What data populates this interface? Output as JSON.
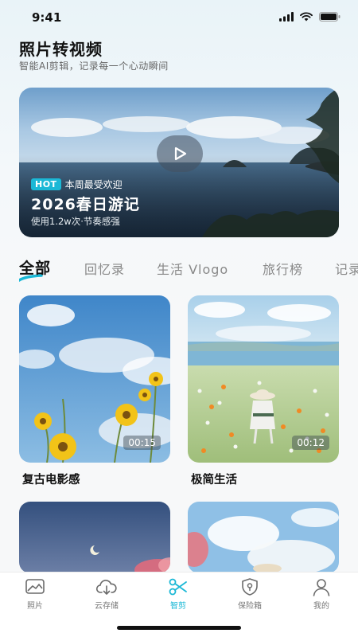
{
  "status_bar": {
    "time": "9:41",
    "icons": [
      "signal-icon",
      "wifi-icon",
      "battery-icon"
    ]
  },
  "header": {
    "title": "照片转视频",
    "subtitle": "智能AI剪辑，记录每一个心动瞬间"
  },
  "hero": {
    "badge": "HOT",
    "badge_text": "本周最受欢迎",
    "title": "2026春日游记",
    "meta": "使用1.2w次·节奏感强",
    "icon": "play-icon"
  },
  "tabs": [
    {
      "label": "全部",
      "active": true
    },
    {
      "label": "回忆录",
      "active": false
    },
    {
      "label": "生活 Vlogo",
      "active": false
    },
    {
      "label": "旅行榜",
      "active": false
    },
    {
      "label": "记录",
      "active": false
    }
  ],
  "cards": [
    {
      "title": "复古电影感",
      "duration": "00:15"
    },
    {
      "title": "极简生活",
      "duration": "00:12"
    }
  ],
  "bottom_nav": [
    {
      "label": "照片",
      "icon": "photo-icon",
      "active": false
    },
    {
      "label": "云存储",
      "icon": "cloud-download-icon",
      "active": false
    },
    {
      "label": "智剪",
      "icon": "scissors-icon",
      "active": true
    },
    {
      "label": "保险箱",
      "icon": "shield-icon",
      "active": false
    },
    {
      "label": "我的",
      "icon": "user-icon",
      "active": false
    }
  ],
  "colors": {
    "accent": "#1bb8d6",
    "text_primary": "#111111",
    "text_secondary": "#888888",
    "background": "#f4f8fa"
  }
}
